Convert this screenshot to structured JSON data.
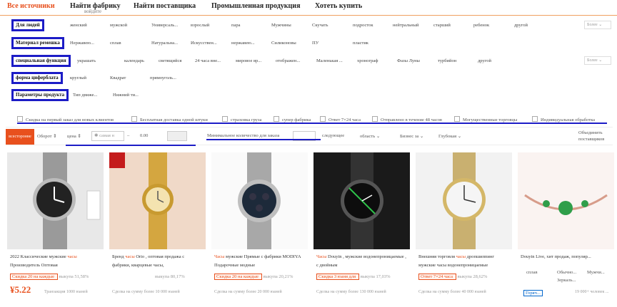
{
  "topnav": {
    "tabs": [
      "Все источники",
      "Найти фабрику",
      "Найти поставщика",
      "Промышленная продукция",
      "Хотеть купить"
    ],
    "sub": "войдите"
  },
  "filters": [
    {
      "label": "Для людей",
      "options": [
        "женский",
        "мужской",
        "Универсаль...",
        "взрослый",
        "пара",
        "Мужчины",
        "Скучать",
        "подросток",
        "нейтральный",
        "старший",
        "ребенок",
        "другой"
      ],
      "more": "Более"
    },
    {
      "label": "Материал ремешка",
      "options": [
        "Нержавею...",
        "сплав",
        "Натуральна...",
        "Искусствен...",
        "нержавею...",
        "Силиконовы",
        "ПУ",
        "пластик"
      ],
      "more": ""
    },
    {
      "label": "специальная функция",
      "options": [
        "украшать",
        "календарь",
        "светящийся",
        "24 часа вне...",
        "мировое вр...",
        "отображен...",
        "Маленькая ...",
        "хронограф",
        "Фазы Луны",
        "турбийон",
        "другой"
      ],
      "more": "Более"
    },
    {
      "label": "форма циферблата",
      "options": [
        "круглый",
        "Квадрат",
        "прямоуголь..."
      ],
      "more": ""
    },
    {
      "label": "Параметры продукта",
      "options": [
        "Тип движе...",
        "Нижний ти..."
      ],
      "more": ""
    }
  ],
  "checkboxes": [
    "Скидка на первый заказ для новых клиентов",
    "Бесплатная доставка одной штуки",
    "страховка груза",
    "супер фабрика",
    "Ответ 7×24 часа",
    "Отправлено в течение 48 часов",
    "Могущественные торговцы",
    "Индивидуальная обработка"
  ],
  "sortbar": {
    "overall": "всесторонне",
    "turnover": "Оборот",
    "price": "цена",
    "price_min": "самая н",
    "price_max": "0.00",
    "min_qty": "Минимальное количество для заказа",
    "next": "следующее",
    "region": "область",
    "business": "Бизнес за",
    "depth": "Глубокая",
    "merge": "Объединить поставщиков"
  },
  "products": [
    {
      "title_pre": "2022 Классические мужские ",
      "title_red": "часы",
      "title_post": " Производитель Оптовая",
      "promo": "Скидка 20 на каждые ",
      "rate": "выкупа 51,58%",
      "price": "¥5.22",
      "deal": "Транзакция 1000 юаней"
    },
    {
      "title_pre": "Бренд ",
      "title_red": "часы",
      "title_post": " Orio , оптовая продажа с фабрики, кварцевые часы,",
      "promo": "",
      "rate": "выкупа 80,17%",
      "price": "",
      "deal": "Сделка на сумму более 10 000 юаней"
    },
    {
      "title_pre": "",
      "title_red": "Часы",
      "title_post": " мужские Прямые с фабрики MODIYA Подарочные модные",
      "promo": "Скидка 20 на каждые ",
      "rate": "выкупа 20,21%",
      "price": "",
      "deal": "Сделка на сумму более 20 000 юаней"
    },
    {
      "title_pre": "",
      "title_red": "Часы",
      "title_post": " Douyin , мужские водонепроницаемые , с двойным",
      "promo": "Скидка 3 юаня для ",
      "rate": "выкупа 17,03%",
      "price": "",
      "deal": "Сделка на сумму более 130 000 юаней"
    },
    {
      "title_pre": "Внешняя торговля ",
      "title_red": "часы",
      "title_post": " дропшиппинг мужские часы водонепроницаемые",
      "promo": "Ответ 7×24 часа ",
      "rate": "выкупа 28,62%",
      "price": "",
      "deal": "Сделка на сумму более 40 000 юаней"
    },
    {
      "title_pre": "Douyin Live, хит продаж, популяр...",
      "title_red": "",
      "title_post": "",
      "promo": "",
      "rate": "",
      "price": "",
      "deal": "19 000+ человек ..."
    }
  ],
  "product6_tags": [
    "сплав",
    "Обычно...",
    "Мужчи...",
    "Зеркаль...",
    "Горяч..."
  ]
}
